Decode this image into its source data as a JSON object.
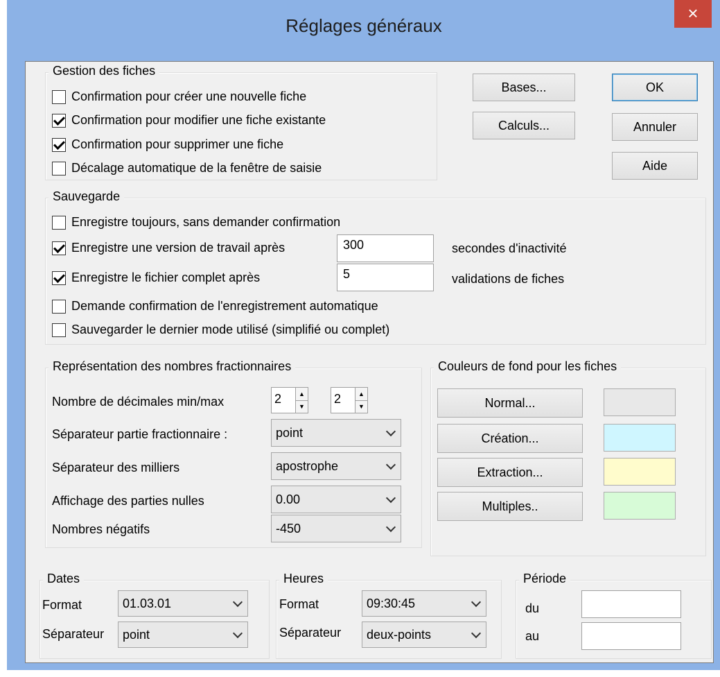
{
  "window": {
    "title": "Réglages généraux",
    "close_glyph": "×"
  },
  "gestion": {
    "legend": "Gestion des fiches",
    "items": [
      {
        "label": "Confirmation pour créer une nouvelle fiche",
        "checked": false
      },
      {
        "label": "Confirmation pour modifier une fiche existante",
        "checked": true
      },
      {
        "label": "Confirmation pour supprimer une fiche",
        "checked": true
      },
      {
        "label": "Décalage automatique de la fenêtre de saisie",
        "checked": false
      }
    ]
  },
  "buttons": {
    "bases": "Bases...",
    "calculs": "Calculs...",
    "ok": "OK",
    "annuler": "Annuler",
    "aide": "Aide"
  },
  "sauvegarde": {
    "legend": "Sauvegarde",
    "always": {
      "label": "Enregistre toujours, sans demander confirmation",
      "checked": false
    },
    "work_version": {
      "label": "Enregistre une version de travail après",
      "checked": true,
      "value": "300",
      "suffix": "secondes d'inactivité"
    },
    "full_file": {
      "label": "Enregistre le fichier complet après",
      "checked": true,
      "value": "5",
      "suffix": "validations de fiches"
    },
    "confirm_auto": {
      "label": "Demande confirmation de l'enregistrement automatique",
      "checked": false
    },
    "last_mode": {
      "label": "Sauvegarder le dernier mode utilisé (simplifié ou complet)",
      "checked": false
    }
  },
  "nombres": {
    "legend": "Représentation des nombres fractionnaires",
    "decimals_label": "Nombre de décimales min/max",
    "dec_min": "2",
    "dec_max": "2",
    "frac_sep_label": "Séparateur partie fractionnaire :",
    "frac_sep_value": "point",
    "thousands_label": "Séparateur des milliers",
    "thousands_value": "apostrophe",
    "zeros_label": "Affichage des parties nulles",
    "zeros_value": "0.00",
    "negative_label": "Nombres négatifs",
    "negative_value": "-450"
  },
  "couleurs": {
    "legend": "Couleurs de fond pour les fiches",
    "items": [
      {
        "label": "Normal...",
        "color": "#e8e8e8"
      },
      {
        "label": "Création...",
        "color": "#cff6ff"
      },
      {
        "label": "Extraction...",
        "color": "#fffccc"
      },
      {
        "label": "Multiples..",
        "color": "#d7fbd7"
      }
    ]
  },
  "dates": {
    "legend": "Dates",
    "format_label": "Format",
    "format_value": "01.03.01",
    "sep_label": "Séparateur",
    "sep_value": "point"
  },
  "heures": {
    "legend": "Heures",
    "format_label": "Format",
    "format_value": "09:30:45",
    "sep_label": "Séparateur",
    "sep_value": "deux-points"
  },
  "periode": {
    "legend": "Période",
    "du_label": "du",
    "au_label": "au",
    "du_value": "",
    "au_value": ""
  }
}
